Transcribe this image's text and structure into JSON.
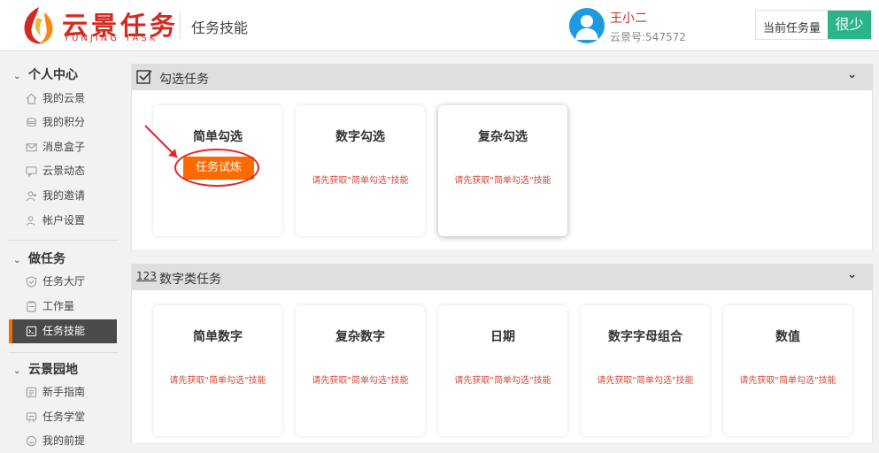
{
  "header": {
    "logo_text": "云景任务",
    "logo_sub": "YUNJING TASK",
    "page_title": "任务技能",
    "user_name": "王小二",
    "user_id": "云景号:547572",
    "task_label": "当前任务量",
    "task_value": "很少"
  },
  "sidebar": {
    "groups": [
      {
        "title": "个人中心",
        "items": [
          {
            "label": "我的云景",
            "icon": "home-icon"
          },
          {
            "label": "我的积分",
            "icon": "coins-icon"
          },
          {
            "label": "消息盒子",
            "icon": "mail-icon"
          },
          {
            "label": "云景动态",
            "icon": "chat-icon"
          },
          {
            "label": "我的邀请",
            "icon": "user-add-icon"
          },
          {
            "label": "帐户设置",
            "icon": "user-settings-icon"
          }
        ]
      },
      {
        "title": "做任务",
        "items": [
          {
            "label": "任务大厅",
            "icon": "shield-check-icon"
          },
          {
            "label": "工作量",
            "icon": "clipboard-icon"
          },
          {
            "label": "任务技能",
            "icon": "skill-icon",
            "active": true
          }
        ]
      },
      {
        "title": "云景园地",
        "items": [
          {
            "label": "新手指南",
            "icon": "guide-icon"
          },
          {
            "label": "任务学堂",
            "icon": "school-icon"
          },
          {
            "label": "我的前提",
            "icon": "smile-icon"
          }
        ]
      }
    ]
  },
  "sections": [
    {
      "title": "勾选任务",
      "icon": "checkbox-icon",
      "cards": [
        {
          "title": "简单勾选",
          "button": "任务试炼"
        },
        {
          "title": "数字勾选",
          "note": "请先获取\"简单勾选\"技能"
        },
        {
          "title": "复杂勾选",
          "note": "请先获取\"简单勾选\"技能"
        }
      ]
    },
    {
      "title": "数字类任务",
      "icon_text": "123",
      "cards": [
        {
          "title": "简单数字",
          "note": "请先获取\"简单勾选\"技能"
        },
        {
          "title": "复杂数字",
          "note": "请先获取\"简单勾选\"技能"
        },
        {
          "title": "日期",
          "note": "请先获取\"简单勾选\"技能"
        },
        {
          "title": "数字字母组合",
          "note": "请先获取\"简单勾选\"技能"
        },
        {
          "title": "数值",
          "note": "请先获取\"简单勾选\"技能"
        }
      ]
    }
  ],
  "colors": {
    "brand_red": "#d32a1f",
    "accent_orange": "#ff6a00",
    "status_green": "#2bb48a",
    "note_red": "#d0493a",
    "annotation_red": "#e2262a"
  }
}
